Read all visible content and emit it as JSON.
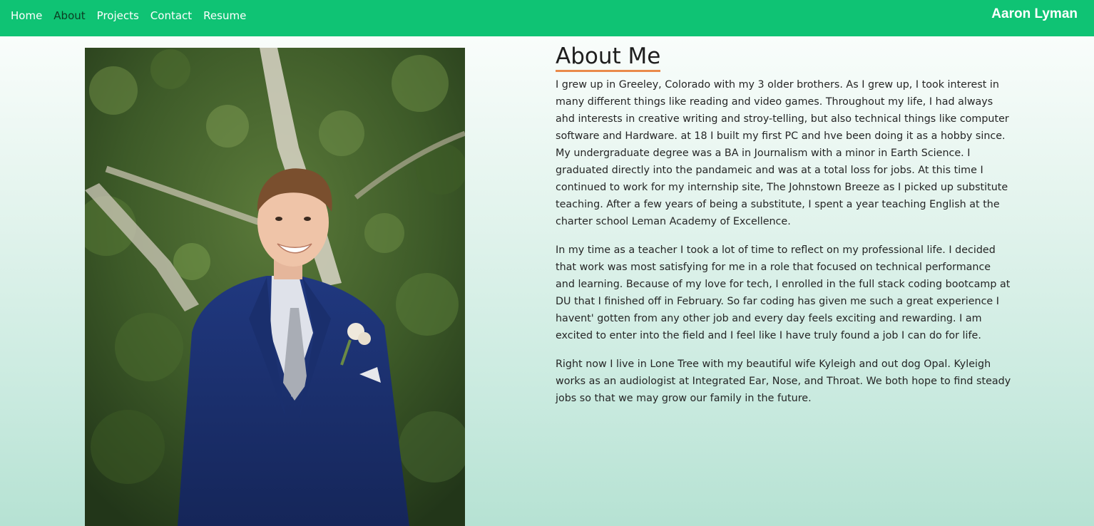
{
  "nav": {
    "links": [
      {
        "label": "Home"
      },
      {
        "label": "About"
      },
      {
        "label": "Projects"
      },
      {
        "label": "Contact"
      },
      {
        "label": "Resume"
      }
    ],
    "active": "About",
    "brand": "Aaron Lyman"
  },
  "colors": {
    "navbar": "#0fc374",
    "active_link": "#0b3d22",
    "heading_underline": "#ea8a4a"
  },
  "photo": {
    "description_icon": "portrait-photo"
  },
  "about": {
    "heading": "About Me",
    "paragraphs": [
      "I grew up in Greeley, Colorado with my 3 older brothers. As I grew up, I took interest in many different things like reading and video games. Throughout my life, I had always ahd interests in creative writing and stroy-telling, but also technical things like computer software and Hardware. at 18 I built my first PC and hve been doing it as a hobby since. My undergraduate degree was a BA in Journalism with a minor in Earth Science. I graduated directly into the pandameic and was at a total loss for jobs. At this time I continued to work for my internship site, The Johnstown Breeze as I picked up substitute teaching. After a few years of being a substitute, I spent a year teaching English at the charter school Leman Academy of Excellence.",
      "In my time as a teacher I took a lot of time to reflect on my professional life. I decided that work was most satisfying for me in a role that focused on technical performance and learning. Because of my love for tech, I enrolled in the full stack coding bootcamp at DU that I finished off in February. So far coding has given me such a great experience I havent' gotten from any other job and every day feels exciting and rewarding. I am excited to enter into the field and I feel like I have truly found a job I can do for life.",
      "Right now I live in Lone Tree with my beautiful wife Kyleigh and out dog Opal. Kyleigh works as an audiologist at Integrated Ear, Nose, and Throat. We both hope to find steady jobs so that we may grow our family in the future."
    ]
  }
}
